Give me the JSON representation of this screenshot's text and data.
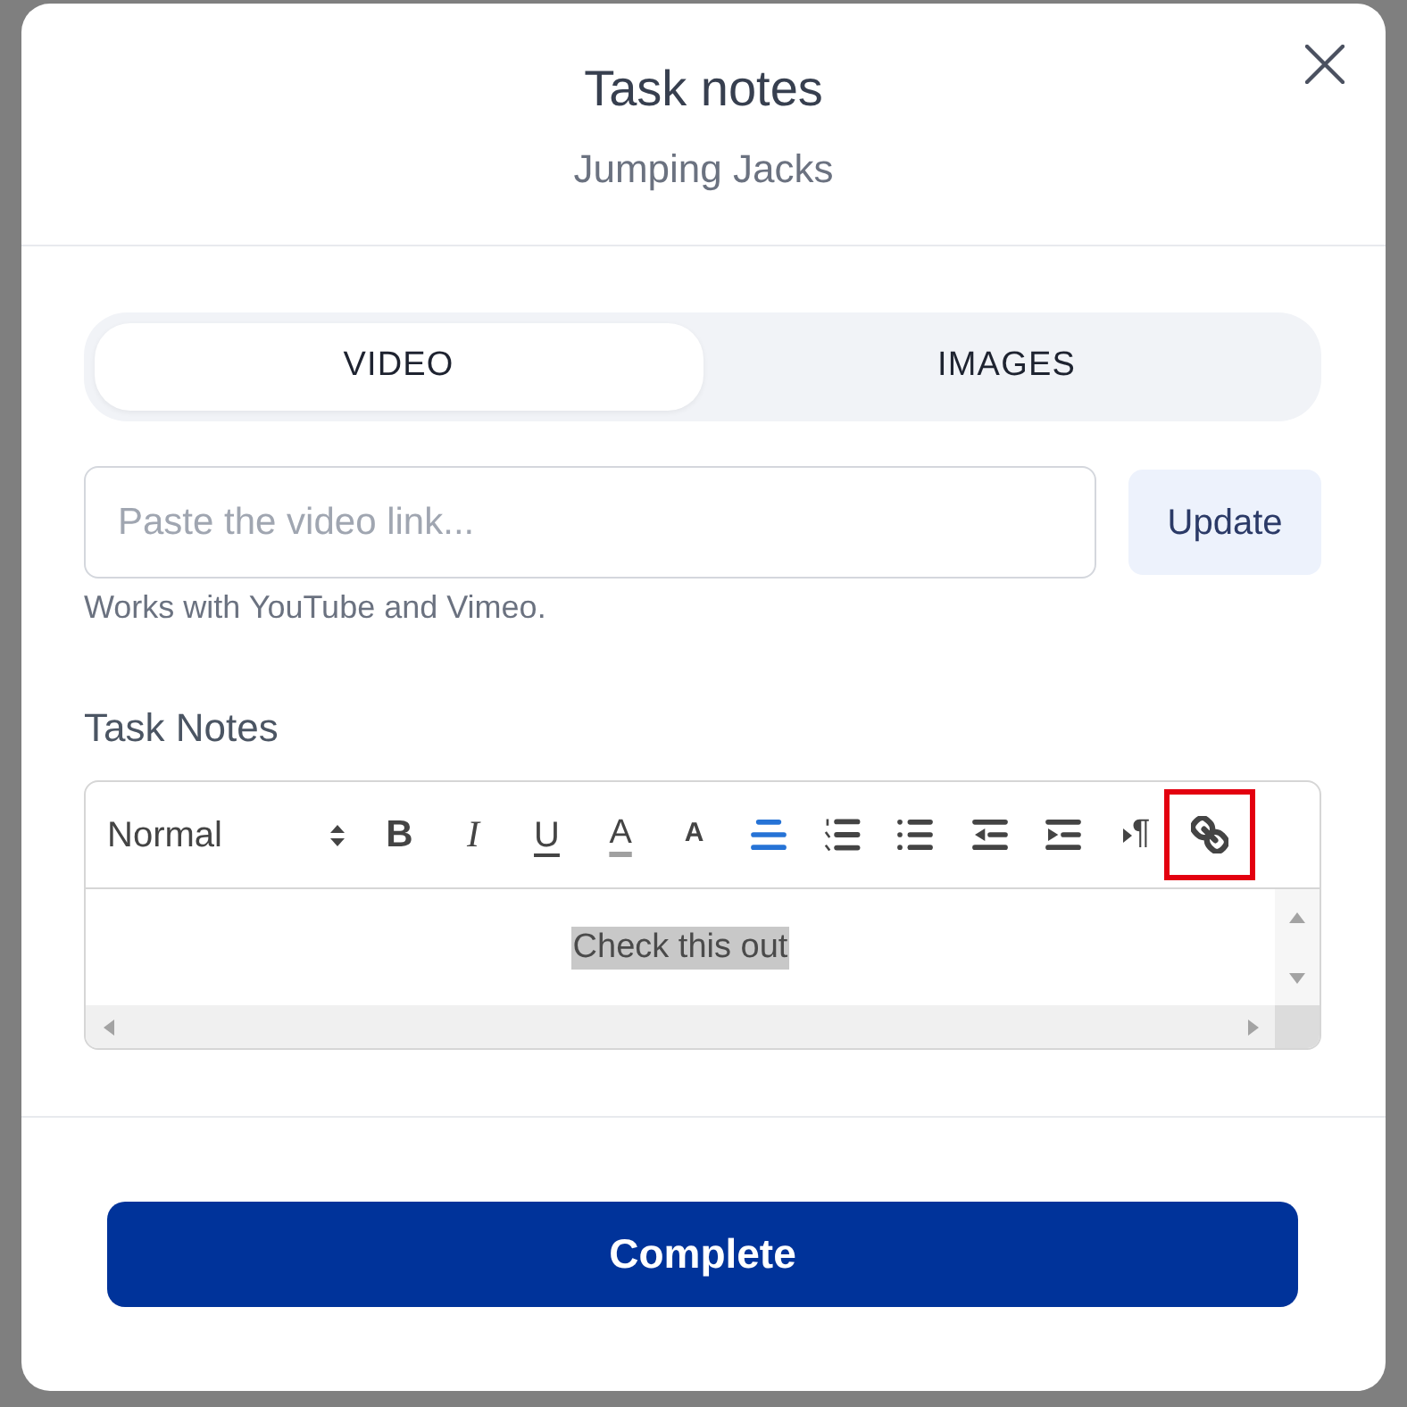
{
  "dialog": {
    "title": "Task notes",
    "subtitle": "Jumping Jacks"
  },
  "tabs": [
    {
      "label": "VIDEO",
      "selected": true
    },
    {
      "label": "IMAGES",
      "selected": false
    }
  ],
  "video_link": {
    "placeholder": "Paste the video link...",
    "button": "Update",
    "hint": "Works with YouTube and Vimeo."
  },
  "editor": {
    "label": "Task Notes",
    "toolbar": [
      {
        "kind": "header",
        "label": "Normal",
        "active": false,
        "highlighted": false
      },
      {
        "kind": "bold",
        "glyph": "B",
        "active": false,
        "highlighted": false
      },
      {
        "kind": "italic",
        "glyph": "I",
        "active": false,
        "highlighted": false
      },
      {
        "kind": "underline",
        "glyph": "U",
        "active": false,
        "highlighted": false
      },
      {
        "kind": "color",
        "glyph": "A",
        "active": false,
        "highlighted": false
      },
      {
        "kind": "background",
        "glyph": "A",
        "active": false,
        "highlighted": false
      },
      {
        "kind": "align",
        "active": true,
        "highlighted": false
      },
      {
        "kind": "ordered-list",
        "active": false,
        "highlighted": false
      },
      {
        "kind": "bullet-list",
        "active": false,
        "highlighted": false
      },
      {
        "kind": "outdent",
        "active": false,
        "highlighted": false
      },
      {
        "kind": "indent",
        "active": false,
        "highlighted": false
      },
      {
        "kind": "direction",
        "glyph": "¶",
        "active": false,
        "highlighted": false
      },
      {
        "kind": "link",
        "active": false,
        "highlighted": true
      }
    ],
    "content": {
      "text": "Check this out",
      "selected": true
    }
  },
  "complete_button": {
    "label": "Complete"
  }
}
